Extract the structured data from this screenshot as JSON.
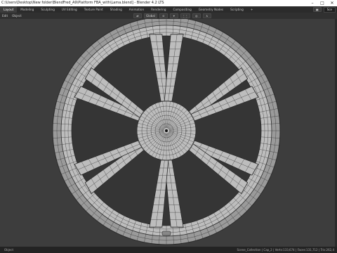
{
  "window": {
    "title": "C:\\Users\\Desktop\\New folder\\BlendFred_A9\\Platform FBA_with\\Lama.blend] - Blender 4.2 LTS"
  },
  "workspaces": [
    "Layout",
    "Modeling",
    "Sculpting",
    "UV Editing",
    "Texture Paint",
    "Shading",
    "Animation",
    "Rendering",
    "Compositing",
    "Geometry Nodes",
    "Scripting",
    "+"
  ],
  "active_workspace": "Layout",
  "top_right": {
    "scene": "Sce"
  },
  "header": {
    "menus": [
      "Edit",
      "Object"
    ],
    "transform_orientation": "Global"
  },
  "status": {
    "left": "Object",
    "right": "Scene_Collection | Cap_2 | Verts:133,674 | Faces:131,712 | Tris:262,4"
  },
  "colors": {
    "viewport_bg": "#3d3d3d",
    "mesh_fill": "#bdbdbd",
    "wire": "#2a2a2a",
    "accent_active": "#3d3d3d"
  }
}
